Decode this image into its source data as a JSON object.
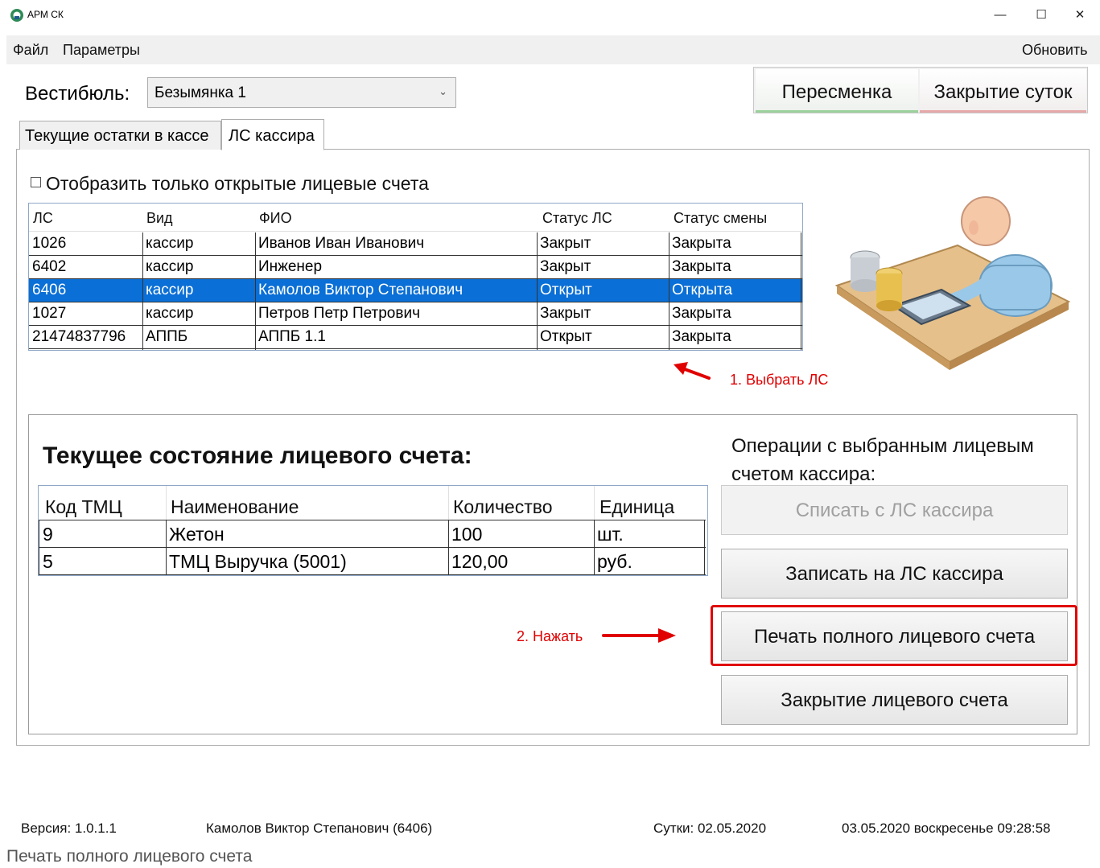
{
  "window": {
    "title": "АРМ СК",
    "icon": "app-logo-icon",
    "controls": [
      "minimize-icon",
      "maximize-icon",
      "close-icon"
    ]
  },
  "menu": {
    "file": "Файл",
    "params": "Параметры",
    "refresh": "Обновить"
  },
  "vestibule": {
    "label": "Вестибюль:",
    "selected": "Безымянка 1"
  },
  "top_buttons": {
    "shift": "Пересменка",
    "close_day": "Закрытие суток"
  },
  "tabs": [
    {
      "label": "Текущие остатки в кассе",
      "active": false
    },
    {
      "label": "ЛС кассира",
      "active": true
    }
  ],
  "filter": {
    "label": "Отобразить только открытые лицевые счета",
    "checked": false
  },
  "accounts_table": {
    "headers": [
      "ЛС",
      "Вид",
      "ФИО",
      "Статус ЛС",
      "Статус смены"
    ],
    "rows": [
      [
        "1026",
        "кассир",
        "Иванов Иван Иванович",
        "Закрыт",
        "Закрыта"
      ],
      [
        "6402",
        "кассир",
        "Инженер",
        "Закрыт",
        "Закрыта"
      ],
      [
        "6406",
        "кассир",
        "Камолов Виктор Степанович",
        "Открыт",
        "Открыта"
      ],
      [
        "1027",
        "кассир",
        "Петров Петр Петрович",
        "Закрыт",
        "Закрыта"
      ],
      [
        "21474837796",
        "АППБ",
        "АППБ 1.1",
        "Открыт",
        "Закрыта"
      ]
    ],
    "selected_index": 2
  },
  "illustration": "cashier-illustration",
  "annotations": {
    "step1": "1. Выбрать ЛС",
    "step2": "2. Нажать",
    "color": "#e00000"
  },
  "status": {
    "title": "Текущее состояние лицевого счета:",
    "headers": [
      "Код ТМЦ",
      "Наименование",
      "Количество",
      "Единица"
    ],
    "rows": [
      [
        "9",
        "Жетон",
        "100",
        "шт."
      ],
      [
        "5",
        "ТМЦ Выручка (5001)",
        "120,00",
        "руб."
      ]
    ]
  },
  "operations": {
    "title": "Операции с выбранным лицевым счетом кассира:",
    "writeoff": "Списать с ЛС кассира",
    "writeoff_enabled": false,
    "credit": "Записать на ЛС кассира",
    "print": "Печать полного лицевого счета",
    "close": "Закрытие лицевого счета"
  },
  "statusbar": {
    "version": "Версия: 1.0.1.1",
    "user": "Камолов Виктор Степанович (6406)",
    "day": "Сутки: 02.05.2020",
    "datetime": "03.05.2020 воскресенье 09:28:58"
  },
  "caption": "Печать полного лицевого счета",
  "colors": {
    "selection": "#0a6fd6",
    "shift_accent": "#9bd19b",
    "close_day_accent": "#e6a8a8"
  }
}
